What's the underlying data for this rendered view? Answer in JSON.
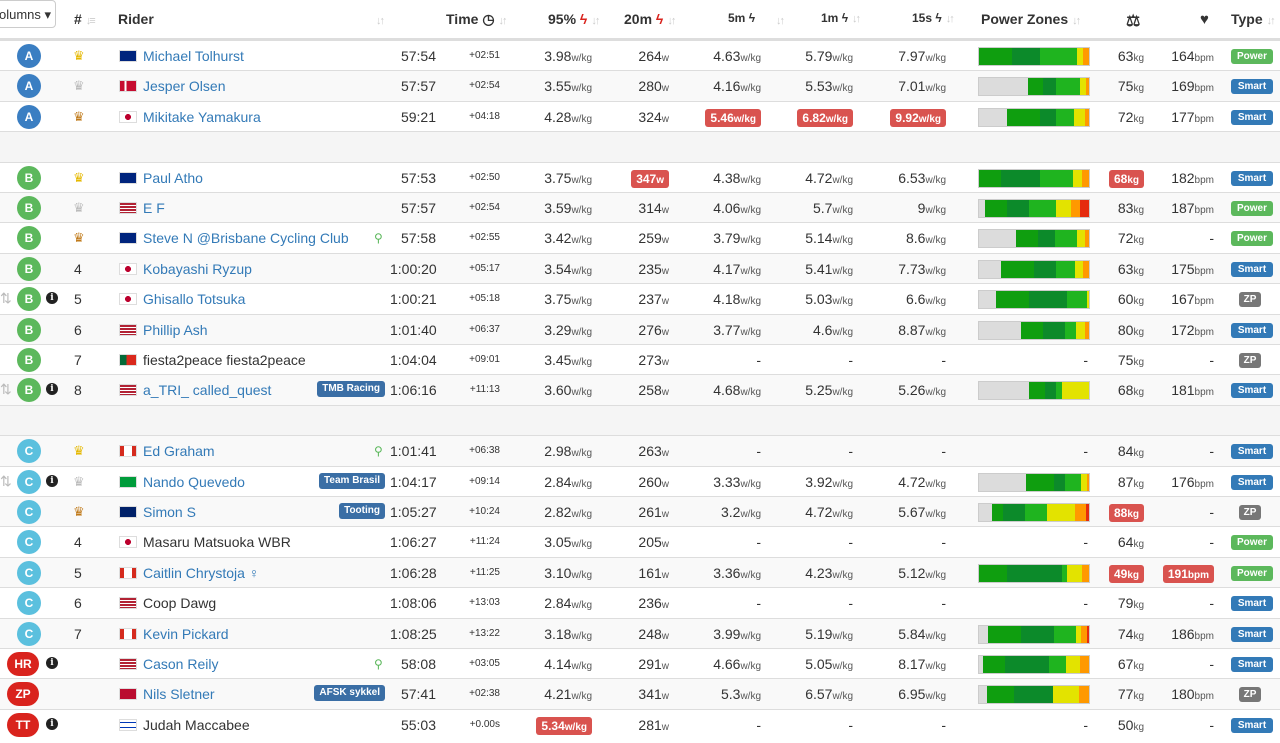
{
  "header": {
    "columns_button": "olumns",
    "place": "#",
    "rider": "Rider",
    "time": "Time",
    "p95": "95%",
    "p20m": "20m",
    "p5m": "5m",
    "p1m": "1m",
    "p15s": "15s",
    "power_zones": "Power Zones",
    "type": "Type"
  },
  "zone_colors": {
    "z1": "#dcdcdc",
    "z2": "#0f9e0f",
    "z3": "#0c8a2a",
    "z4": "#1fb41f",
    "z5": "#e3e300",
    "z6": "#ff9900",
    "z7": "#e52b0e"
  },
  "rows": [
    {
      "cat": "A",
      "place": "gold",
      "name": "Michael Tolhurst",
      "flag": "AU",
      "time": "57:54",
      "gap": "+02:51",
      "p95": "3.98",
      "p20": "264",
      "p5": "4.63",
      "p1": "5.79",
      "p15": "7.97",
      "pz": [
        0,
        30,
        25,
        34,
        6,
        5,
        0
      ],
      "wt": "63",
      "hr": "164",
      "type": "Power"
    },
    {
      "cat": "A",
      "place": "silver",
      "name": "Jesper Olsen",
      "flag": "DK",
      "time": "57:57",
      "gap": "+02:54",
      "p95": "3.55",
      "p20": "280",
      "p5": "4.16",
      "p1": "5.53",
      "p15": "7.01",
      "pz": [
        47,
        15,
        12,
        23,
        6,
        3,
        0
      ],
      "wt": "75",
      "hr": "169",
      "type": "Smart"
    },
    {
      "cat": "A",
      "place": "bronze",
      "name": "Mikitake Yamakura",
      "flag": "JP",
      "time": "59:21",
      "gap": "+04:18",
      "p95": "4.28",
      "p20": "324",
      "p5": "5.46",
      "p1": "6.82",
      "p15": "9.92",
      "hi": [
        "p5",
        "p1",
        "p15"
      ],
      "pz": [
        25,
        30,
        15,
        16,
        10,
        4,
        0
      ],
      "wt": "72",
      "hr": "177",
      "type": "Smart"
    },
    {
      "spacer": true
    },
    {
      "cat": "B",
      "place": "gold",
      "name": "Paul Atho",
      "flag": "AU",
      "time": "57:53",
      "gap": "+02:50",
      "p95": "3.75",
      "p20": "347",
      "p5": "4.38",
      "p1": "4.72",
      "p15": "6.53",
      "hi": [
        "p20",
        "wt"
      ],
      "pz": [
        0,
        20,
        35,
        30,
        9,
        6,
        0
      ],
      "wt": "68",
      "hr": "182",
      "type": "Smart"
    },
    {
      "cat": "B",
      "place": "silver",
      "name": "E F",
      "flag": "US",
      "time": "57:57",
      "gap": "+02:54",
      "p95": "3.59",
      "p20": "314",
      "p5": "4.06",
      "p1": "5.7",
      "p15": "9",
      "pz": [
        5,
        20,
        20,
        25,
        14,
        8,
        8
      ],
      "wt": "83",
      "hr": "187",
      "type": "Power"
    },
    {
      "cat": "B",
      "place": "bronze",
      "name": "Steve N @Brisbane Cycling Club",
      "flag": "AU",
      "search": true,
      "time": "57:58",
      "gap": "+02:55",
      "p95": "3.42",
      "p20": "259",
      "p5": "3.79",
      "p1": "5.14",
      "p15": "8.6",
      "pz": [
        34,
        20,
        15,
        20,
        7,
        4,
        0
      ],
      "wt": "72",
      "hr": "-",
      "type": "Power"
    },
    {
      "cat": "B",
      "place": "4",
      "name": "Kobayashi Ryzup",
      "flag": "JP",
      "time": "1:00:20",
      "gap": "+05:17",
      "p95": "3.54",
      "p20": "235",
      "p5": "4.17",
      "p1": "5.41",
      "p15": "7.73",
      "pz": [
        20,
        30,
        20,
        17,
        8,
        5,
        0
      ],
      "wt": "63",
      "hr": "175",
      "type": "Smart"
    },
    {
      "cat": "B",
      "place": "5",
      "name": "Ghisallo Totsuka",
      "flag": "JP",
      "info": true,
      "updown": true,
      "time": "1:00:21",
      "gap": "+05:18",
      "p95": "3.75",
      "p20": "237",
      "p5": "4.18",
      "p1": "5.03",
      "p15": "6.6",
      "pz": [
        15,
        30,
        35,
        18,
        2,
        0,
        0
      ],
      "wt": "60",
      "hr": "167",
      "type": "ZP"
    },
    {
      "cat": "B",
      "place": "6",
      "name": "Phillip Ash",
      "flag": "US",
      "time": "1:01:40",
      "gap": "+06:37",
      "p95": "3.29",
      "p20": "276",
      "p5": "3.77",
      "p1": "4.6",
      "p15": "8.87",
      "pz": [
        38,
        20,
        20,
        10,
        8,
        4,
        0
      ],
      "wt": "80",
      "hr": "172",
      "type": "Smart"
    },
    {
      "cat": "B",
      "place": "7",
      "name": "fiesta2peace fiesta2peace",
      "flag": "PT",
      "plain": true,
      "time": "1:04:04",
      "gap": "+09:01",
      "p95": "3.45",
      "p20": "273",
      "p5": "-",
      "p1": "-",
      "p15": "-",
      "pz": null,
      "wt": "75",
      "hr": "-",
      "type": "ZP"
    },
    {
      "cat": "B",
      "place": "8",
      "name": "a_TRI_ called_quest",
      "flag": "US",
      "team": "TMB Racing",
      "info": true,
      "updown": true,
      "time": "1:06:16",
      "gap": "+11:13",
      "p95": "3.60",
      "p20": "258",
      "p5": "4.68",
      "p1": "5.25",
      "p15": "5.26",
      "pz": [
        45,
        15,
        10,
        5,
        25,
        0,
        0
      ],
      "wt": "68",
      "hr": "181",
      "type": "Smart"
    },
    {
      "spacer": true
    },
    {
      "cat": "C",
      "place": "gold",
      "name": "Ed Graham",
      "flag": "CA",
      "search": true,
      "time": "1:01:41",
      "gap": "+06:38",
      "p95": "2.98",
      "p20": "263",
      "p5": "-",
      "p1": "-",
      "p15": "-",
      "pz": null,
      "wt": "84",
      "hr": "-",
      "type": "Smart"
    },
    {
      "cat": "C",
      "place": "silver",
      "name": "Nando Quevedo",
      "flag": "BR",
      "team": "Team Brasil",
      "info": true,
      "updown": true,
      "time": "1:04:17",
      "gap": "+09:14",
      "p95": "2.84",
      "p20": "260",
      "p5": "3.33",
      "p1": "3.92",
      "p15": "4.72",
      "pz": [
        43,
        25,
        10,
        15,
        5,
        2,
        0
      ],
      "wt": "87",
      "hr": "176",
      "type": "Smart"
    },
    {
      "cat": "C",
      "place": "bronze",
      "name": "Simon S",
      "flag": "GB",
      "team": "Tooting",
      "time": "1:05:27",
      "gap": "+10:24",
      "p95": "2.82",
      "p20": "261",
      "p5": "3.2",
      "p1": "4.72",
      "p15": "5.67",
      "hi": [
        "wt"
      ],
      "pz": [
        12,
        10,
        20,
        20,
        25,
        10,
        3
      ],
      "wt": "88",
      "hr": "-",
      "type": "ZP"
    },
    {
      "cat": "C",
      "place": "4",
      "name": "Masaru Matsuoka WBR",
      "flag": "JP",
      "plain": true,
      "time": "1:06:27",
      "gap": "+11:24",
      "p95": "3.05",
      "p20": "205",
      "p5": "-",
      "p1": "-",
      "p15": "-",
      "pz": null,
      "wt": "64",
      "hr": "-",
      "type": "Power"
    },
    {
      "cat": "C",
      "place": "5",
      "name": "Caitlin Chrystoja ♀",
      "flag": "CA",
      "time": "1:06:28",
      "gap": "+11:25",
      "p95": "3.10",
      "p20": "161",
      "p5": "3.36",
      "p1": "4.23",
      "p15": "5.12",
      "hi": [
        "wt",
        "hr"
      ],
      "pz": [
        0,
        25,
        50,
        5,
        14,
        6,
        0
      ],
      "wt": "49",
      "hr": "191",
      "type": "Power"
    },
    {
      "cat": "C",
      "place": "6",
      "name": "Coop Dawg",
      "flag": "US",
      "plain": true,
      "time": "1:08:06",
      "gap": "+13:03",
      "p95": "2.84",
      "p20": "236",
      "p5": "-",
      "p1": "-",
      "p15": "-",
      "pz": null,
      "wt": "79",
      "hr": "-",
      "type": "Smart"
    },
    {
      "cat": "C",
      "place": "7",
      "name": "Kevin Pickard",
      "flag": "CA",
      "time": "1:08:25",
      "gap": "+13:22",
      "p95": "3.18",
      "p20": "248",
      "p5": "3.99",
      "p1": "5.19",
      "p15": "5.84",
      "pz": [
        8,
        30,
        30,
        20,
        5,
        5,
        2
      ],
      "wt": "74",
      "hr": "186",
      "type": "Smart"
    },
    {
      "cat": "HR",
      "place": "",
      "name": "Cason Reily",
      "flag": "US",
      "search": true,
      "info": true,
      "time": "58:08",
      "gap": "+03:05",
      "p95": "4.14",
      "p20": "291",
      "p5": "4.66",
      "p1": "5.05",
      "p15": "8.17",
      "pz": [
        4,
        20,
        40,
        15,
        13,
        8,
        0
      ],
      "wt": "67",
      "hr": "-",
      "type": "Smart"
    },
    {
      "cat": "ZP",
      "place": "",
      "name": "Nils Sletner",
      "flag": "NO",
      "team": "AFSK sykkel",
      "time": "57:41",
      "gap": "+02:38",
      "p95": "4.21",
      "p20": "341",
      "p5": "5.3",
      "p1": "6.57",
      "p15": "6.95",
      "pz": [
        7,
        25,
        35,
        0,
        24,
        9,
        0
      ],
      "wt": "77",
      "hr": "180",
      "type": "ZP"
    },
    {
      "cat": "TT",
      "place": "",
      "name": "Judah Maccabee",
      "flag": "IL",
      "plain": true,
      "info": true,
      "time": "55:03",
      "gap": "+0.00s",
      "p95": "5.34",
      "p20": "281",
      "p5": "-",
      "p1": "-",
      "p15": "-",
      "hi": [
        "p95"
      ],
      "pz": null,
      "wt": "50",
      "hr": "-",
      "type": "Smart"
    }
  ]
}
